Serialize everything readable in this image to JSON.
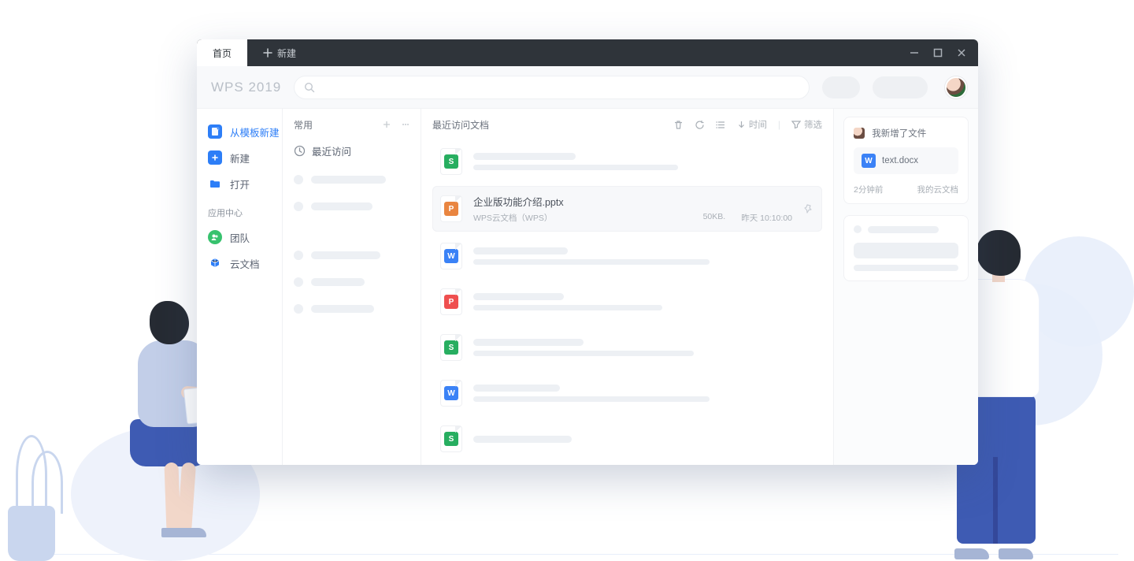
{
  "titlebar": {
    "home_tab": "首页",
    "new_tab": "新建"
  },
  "toolbar": {
    "brand": "WPS 2019"
  },
  "sidebar": {
    "new_from_template": "从模板新建",
    "new": "新建",
    "open": "打开",
    "app_center_heading": "应用中心",
    "team": "团队",
    "cloud_docs": "云文档"
  },
  "recent_col": {
    "header": "常用",
    "recent_title": "最近访问"
  },
  "files_col": {
    "header": "最近访问文档",
    "tool_time": "时间",
    "tool_filter": "筛选",
    "active": {
      "name": "企业版功能介绍.pptx",
      "source": "WPS云文档（WPS）",
      "size": "50KB.",
      "time": "昨天 10:10:00"
    },
    "rows": [
      {
        "type": "s"
      },
      {
        "type": "p",
        "active": true
      },
      {
        "type": "w"
      },
      {
        "type": "pdf"
      },
      {
        "type": "s"
      },
      {
        "type": "w"
      },
      {
        "type": "s"
      }
    ]
  },
  "notif": {
    "title": "我新增了文件",
    "file_name": "text.docx",
    "time_ago": "2分钟前",
    "location": "我的云文档"
  }
}
